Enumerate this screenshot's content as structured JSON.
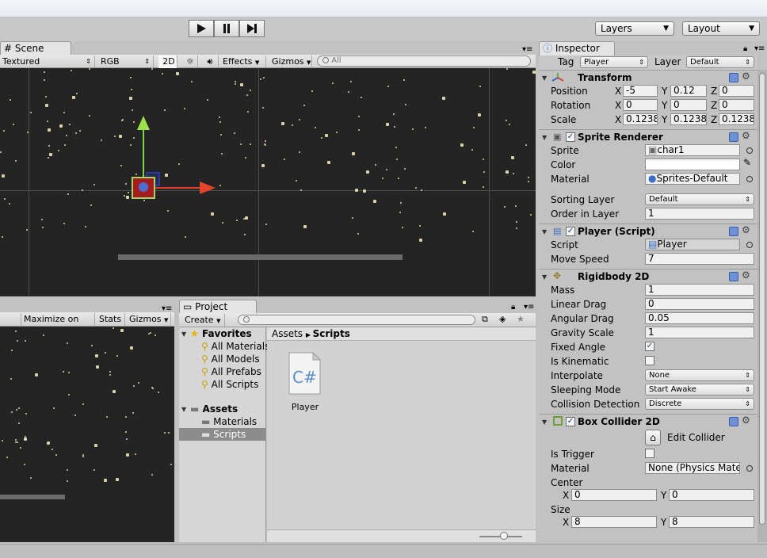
{
  "toolbar": {
    "layers_label": "Layers",
    "layout_label": "Layout"
  },
  "scene": {
    "tab_label": "Scene",
    "render_mode": "Textured",
    "color_mode": "RGB",
    "mode_2d": "2D",
    "effects_label": "Effects",
    "gizmos_label": "Gizmos",
    "search_placeholder": "All"
  },
  "game": {
    "maximize_label": "Maximize on Play",
    "stats_label": "Stats",
    "gizmos_label": "Gizmos"
  },
  "project": {
    "tab_label": "Project",
    "create_label": "Create",
    "favorites_label": "Favorites",
    "favorites": [
      "All Materials",
      "All Models",
      "All Prefabs",
      "All Scripts"
    ],
    "assets_label": "Assets",
    "folders": [
      "Materials",
      "Scripts"
    ],
    "breadcrumb_root": "Assets",
    "breadcrumb_current": "Scripts",
    "files": [
      {
        "name": "Player",
        "icon_text": "C#"
      }
    ]
  },
  "inspector": {
    "tab_label": "Inspector",
    "tag_label": "Tag",
    "tag_value": "Player",
    "layer_label": "Layer",
    "layer_value": "Default",
    "transform": {
      "title": "Transform",
      "position_label": "Position",
      "rotation_label": "Rotation",
      "scale_label": "Scale",
      "x": "X",
      "y": "Y",
      "z": "Z",
      "position": [
        "-5",
        "0.12",
        "0"
      ],
      "rotation": [
        "0",
        "0",
        "0"
      ],
      "scale": [
        "0.1238",
        "0.1238",
        "0.1238"
      ]
    },
    "sprite_renderer": {
      "title": "Sprite Renderer",
      "sprite_label": "Sprite",
      "sprite_value": "char1",
      "color_label": "Color",
      "color_value": "#ffffff",
      "material_label": "Material",
      "material_value": "Sprites-Default",
      "sorting_layer_label": "Sorting Layer",
      "sorting_layer_value": "Default",
      "order_label": "Order in Layer",
      "order_value": "1"
    },
    "player_script": {
      "title": "Player (Script)",
      "script_label": "Script",
      "script_value": "Player",
      "move_speed_label": "Move Speed",
      "move_speed_value": "7"
    },
    "rigidbody": {
      "title": "Rigidbody 2D",
      "mass_label": "Mass",
      "mass_value": "1",
      "linear_drag_label": "Linear Drag",
      "linear_drag_value": "0",
      "angular_drag_label": "Angular Drag",
      "angular_drag_value": "0.05",
      "gravity_label": "Gravity Scale",
      "gravity_value": "1",
      "fixed_angle_label": "Fixed Angle",
      "fixed_angle_checked": true,
      "kinematic_label": "Is Kinematic",
      "kinematic_checked": false,
      "interpolate_label": "Interpolate",
      "interpolate_value": "None",
      "sleeping_label": "Sleeping Mode",
      "sleeping_value": "Start Awake",
      "collision_label": "Collision Detection",
      "collision_value": "Discrete"
    },
    "box_collider": {
      "title": "Box Collider 2D",
      "edit_label": "Edit Collider",
      "trigger_label": "Is Trigger",
      "material_label": "Material",
      "material_value": "None (Physics Mater",
      "center_label": "Center",
      "center_x": "0",
      "center_y": "0",
      "size_label": "Size",
      "size_x": "8",
      "size_y": "8",
      "x": "X",
      "y": "Y"
    }
  }
}
